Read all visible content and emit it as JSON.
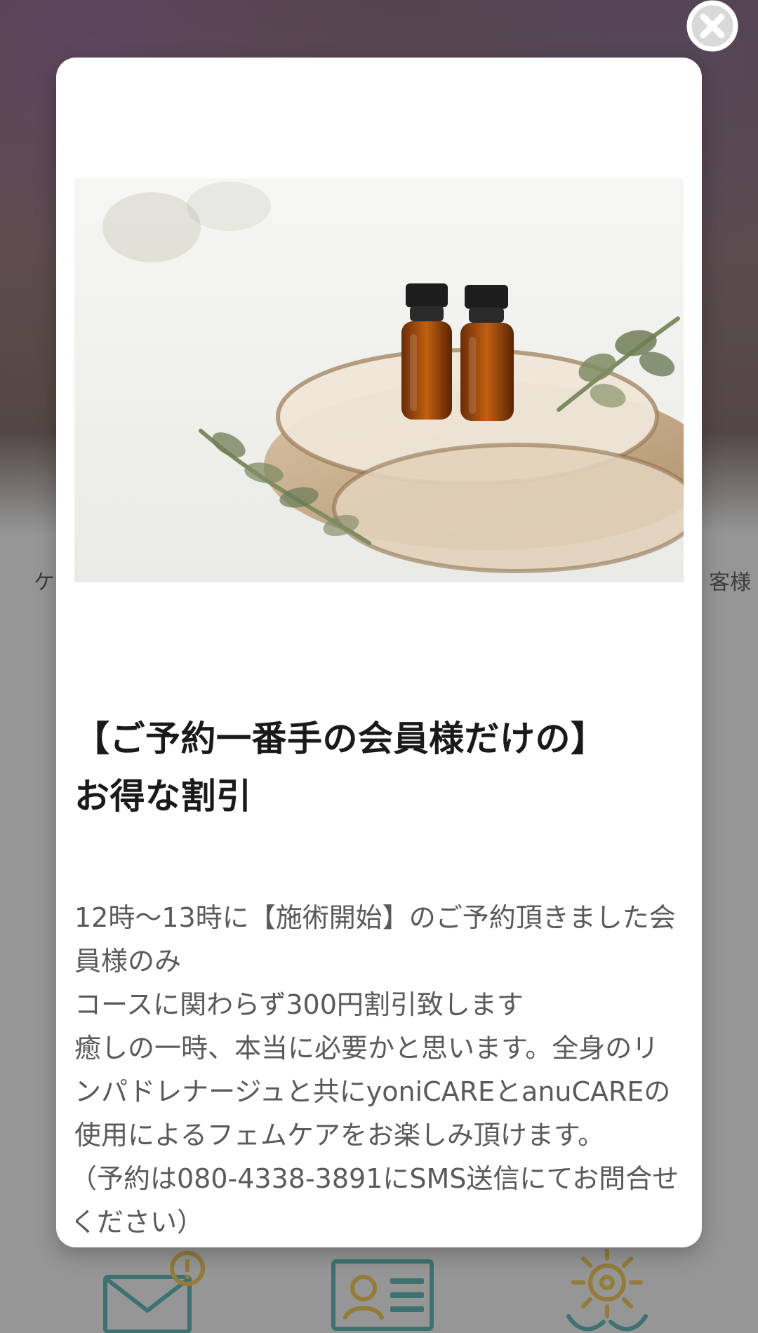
{
  "background": {
    "partial_text_left": "ケ",
    "partial_text_right": "客様",
    "icons": {
      "mail": "mail-alert-icon",
      "profile": "profile-card-icon",
      "care": "care-gear-hands-icon"
    },
    "colors": {
      "dim_overlay": "#505050",
      "teal": "#2f8f8a",
      "mustard": "#c9a126"
    }
  },
  "modal": {
    "close_icon": "close-icon",
    "title_lines": [
      "【ご予約一番手の会員様だけの】",
      "お得な割引"
    ],
    "body_lines": [
      "12時～13時に【施術開始】のご予約頂きました会員様のみ",
      "コースに関わらず300円割引致します",
      "癒しの一時、本当に必要かと思います。全身のリンパドレナージュと共にyoniCAREとanuCAREの使用によるフェムケアをお楽しみ頂けます。",
      "（予約は080-4338-3891にSMS送信にてお問合せください）"
    ],
    "photo": {
      "subject": "aroma-oil-bottles-with-eucalyptus-on-wood-slices"
    }
  }
}
